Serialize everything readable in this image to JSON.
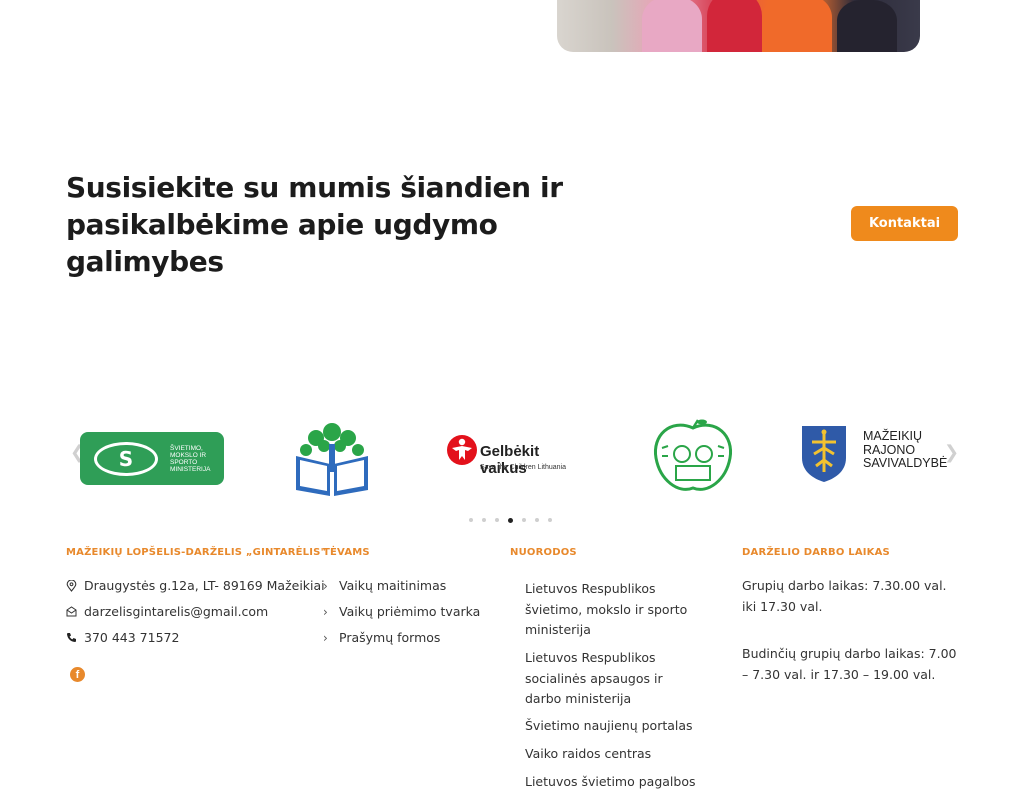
{
  "cta": {
    "title": "Susisiekite su mumis šiandien ir pasikalbėkime apie ugdymo galimybes",
    "button_label": "Kontaktai"
  },
  "partners": {
    "ministry_text": "ŠVIETIMO, MOKSLO IR SPORTO MINISTERIJA",
    "gelbekit_name": "Gelbėkit vaikus",
    "gelbekit_sub": "Save the Children Lithuania",
    "savivaldybe_text": "MAŽEIKIŲ RAJONO SAVIVALDYBĖ",
    "active_slide": 4,
    "slide_count": 7
  },
  "footer": {
    "school": {
      "title": "MAŽEIKIŲ LOPŠELIS-DARŽELIS „GINTARĖLIS\"",
      "address": "Draugystės g.12a, LT- 89169 Mažeikiai",
      "email": "darzelisgintarelis@gmail.com",
      "phone": "370 443 71572"
    },
    "parents": {
      "title": "TĖVAMS",
      "links": [
        "Vaikų maitinimas",
        "Vaikų priėmimo tvarka",
        "Prašymų formos"
      ]
    },
    "links": {
      "title": "NUORODOS",
      "items": [
        "Lietuvos Respublikos švietimo, mokslo ir sporto ministerija",
        "Lietuvos Respublikos socialinės apsaugos ir darbo ministerija",
        "Švietimo naujienų portalas",
        "Vaiko raidos centras",
        "Lietuvos švietimo pagalbos"
      ]
    },
    "hours": {
      "title": "DARŽELIO DARBO LAIKAS",
      "groups": "Grupių darbo laikas: 7.30.00 val. iki 17.30 val.",
      "duty_groups": "Budinčių grupių darbo laikas: 7.00 – 7.30 val. ir 17.30 – 19.00 val."
    }
  },
  "colors": {
    "accent": "#ef8a1c",
    "heading": "#1c1c1c",
    "ministry_green": "#2f9e57"
  }
}
